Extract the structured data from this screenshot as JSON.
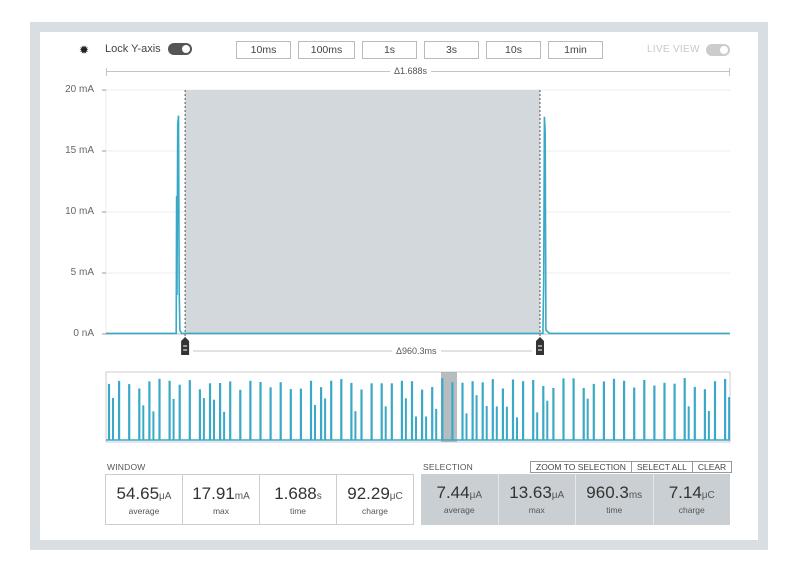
{
  "colors": {
    "trace": "#3aa9c7",
    "selection_fill": "#d3d8dc",
    "accent": "#1e9fc4"
  },
  "toolbar": {
    "settings_icon": "gear-icon",
    "lock_label": "Lock Y-axis",
    "lock_toggle": "on",
    "zoom_buttons": [
      "10ms",
      "100ms",
      "1s",
      "3s",
      "10s",
      "1min"
    ],
    "live_view_label": "LIVE VIEW",
    "live_view_toggle": "off"
  },
  "chart": {
    "window_delta": "Δ1.688s",
    "selection_delta": "Δ960.3ms",
    "y_ticks": [
      "20 mA",
      "15 mA",
      "10 mA",
      "5 mA",
      "0 nA"
    ],
    "y_unit": "mA",
    "y_range": [
      0,
      20
    ],
    "window_range_s": [
      0,
      1.688
    ],
    "selection_s": [
      0.214,
      1.174
    ],
    "marker_icon": "handle-marker-icon"
  },
  "chart_data": {
    "type": "line",
    "x": [
      0,
      0.19,
      0.191,
      0.192,
      0.194,
      0.196,
      0.198,
      0.2,
      0.205,
      1.182,
      1.184,
      1.186,
      1.188,
      1.19,
      1.2,
      1.688
    ],
    "values": [
      0.05,
      0.05,
      11.3,
      3.2,
      17.2,
      17.9,
      3.5,
      0.3,
      0.05,
      0.05,
      4.2,
      17.8,
      16.5,
      0.3,
      0.05,
      0.05
    ],
    "xlabel": "",
    "ylabel": "",
    "ylim": [
      0,
      20
    ],
    "y_tick_labels": [
      "20 mA",
      "15 mA",
      "10 mA",
      "5 mA",
      "0 nA"
    ],
    "grid": true
  },
  "window": {
    "label": "WINDOW",
    "stats": [
      {
        "value": "54.65",
        "unit": "μA",
        "caption": "average"
      },
      {
        "value": "17.91",
        "unit": "mA",
        "caption": "max"
      },
      {
        "value": "1.688",
        "unit": "s",
        "caption": "time"
      },
      {
        "value": "92.29",
        "unit": "μC",
        "caption": "charge"
      }
    ]
  },
  "selection": {
    "label": "SELECTION",
    "buttons": [
      "ZOOM TO SELECTION",
      "SELECT ALL",
      "CLEAR"
    ],
    "stats": [
      {
        "value": "7.44",
        "unit": "μA",
        "caption": "average"
      },
      {
        "value": "13.63",
        "unit": "μA",
        "caption": "max"
      },
      {
        "value": "960.3",
        "unit": "ms",
        "caption": "time"
      },
      {
        "value": "7.14",
        "unit": "μC",
        "caption": "charge"
      }
    ]
  }
}
